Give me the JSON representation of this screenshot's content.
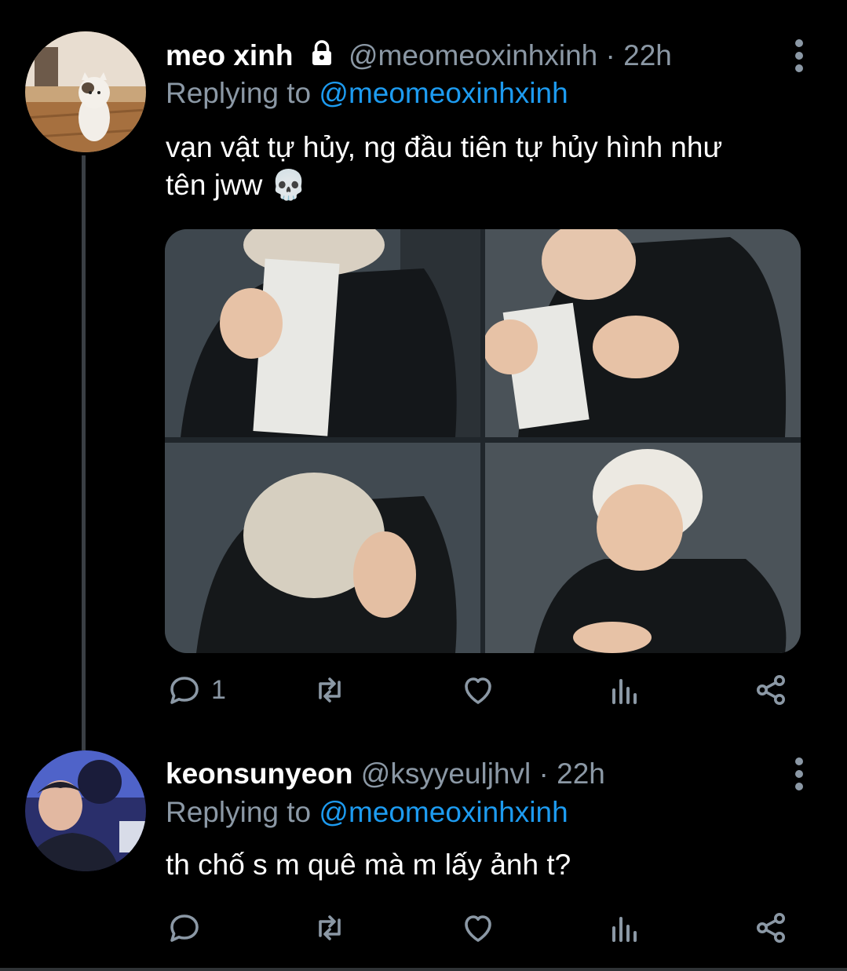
{
  "tweets": [
    {
      "name": "meo xinh",
      "handle": "@meomeoxinhxinh",
      "dot": "·",
      "time": "22h",
      "protected": true,
      "replying_prefix": "Replying to ",
      "replying_to": "@meomeoxinhxinh",
      "text_line1": "vạn vật tự hủy, ng đầu tiên tự hủy hình như",
      "text_line2": "tên jww",
      "emoji": "💀",
      "has_media": true,
      "reply_count": "1",
      "avatar_icon": "cat-avatar"
    },
    {
      "name": "keonsunyeon",
      "handle": "@ksyyeuljhvl",
      "dot": "·",
      "time": "22h",
      "protected": false,
      "replying_prefix": "Replying to ",
      "replying_to": "@meomeoxinhxinh",
      "text_line1": "th chố s m quê mà m lấy ảnh t?",
      "reply_count": "",
      "avatar_icon": "person-avatar"
    }
  ],
  "icons": [
    "reply-icon",
    "retweet-icon",
    "like-icon",
    "analytics-icon",
    "share-icon",
    "more-icon",
    "lock-icon"
  ],
  "colors": {
    "background": "#000000",
    "secondary": "#8b98a5",
    "link": "#1d9bf0"
  }
}
